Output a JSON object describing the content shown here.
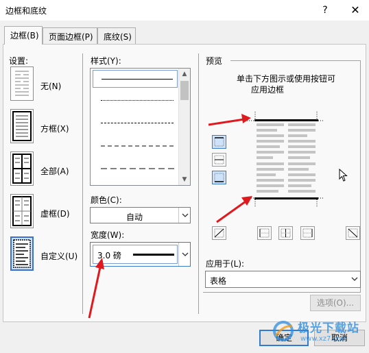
{
  "window": {
    "title": "边框和底纹",
    "help": "?",
    "close": "✕"
  },
  "tabs": [
    {
      "label": "边框(B)"
    },
    {
      "label": "页面边框(P)"
    },
    {
      "label": "底纹(S)"
    }
  ],
  "settings": {
    "heading": "设置:",
    "items": [
      {
        "label": "无(N)"
      },
      {
        "label": "方框(X)"
      },
      {
        "label": "全部(A)"
      },
      {
        "label": "虚框(D)"
      },
      {
        "label": "自定义(U)"
      }
    ],
    "selected": "自定义(U)"
  },
  "style": {
    "heading": "样式(Y):",
    "items": [
      "solid",
      "dotted",
      "dashed-small",
      "dashed",
      "dash-long"
    ],
    "selected_index": 0
  },
  "color": {
    "heading": "颜色(C):",
    "value": "自动"
  },
  "width": {
    "heading": "宽度(W):",
    "value": "3.0 磅"
  },
  "preview": {
    "heading": "预览",
    "hint_line1": "单击下方图示或使用按钮可",
    "hint_line2": "应用边框"
  },
  "apply_to": {
    "heading": "应用于(L):",
    "value": "表格"
  },
  "buttons": {
    "options": "选项(O)...",
    "ok": "确定",
    "cancel": "取消"
  },
  "watermark": {
    "text": "极光下载站",
    "url": "www.xz7.com"
  },
  "colors": {
    "accent": "#3a6fd0",
    "annotation_arrow": "#e0191e",
    "selected_bg": "#cde3fb"
  }
}
